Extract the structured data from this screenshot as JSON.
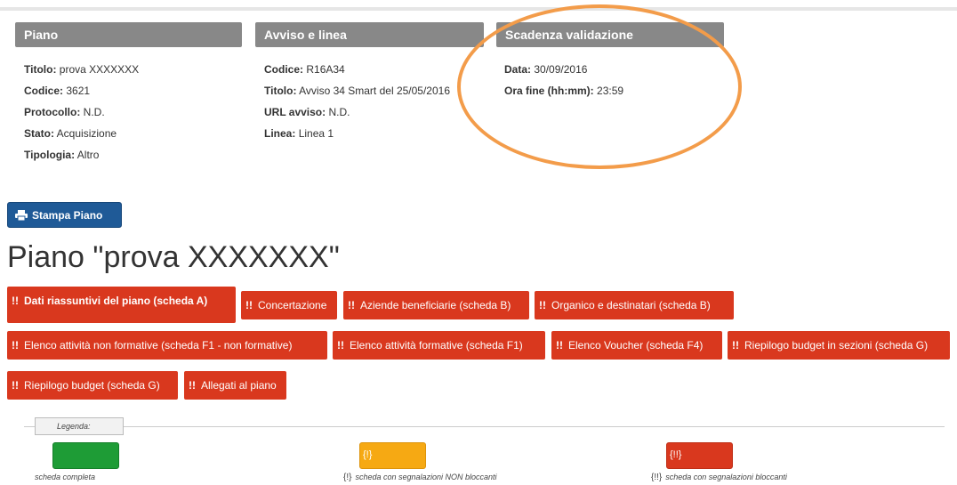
{
  "panels": {
    "piano": {
      "title": "Piano",
      "rows": [
        {
          "label": "Titolo:",
          "value": "prova XXXXXXX"
        },
        {
          "label": "Codice:",
          "value": "3621"
        },
        {
          "label": "Protocollo:",
          "value": "N.D."
        },
        {
          "label": "Stato:",
          "value": "Acquisizione"
        },
        {
          "label": "Tipologia:",
          "value": "Altro"
        }
      ]
    },
    "avviso": {
      "title": "Avviso e linea",
      "rows": [
        {
          "label": "Codice:",
          "value": "R16A34"
        },
        {
          "label": "Titolo:",
          "value": "Avviso 34 Smart del 25/05/2016"
        },
        {
          "label": "URL avviso:",
          "value": "N.D."
        },
        {
          "label": "Linea:",
          "value": "Linea 1"
        }
      ]
    },
    "scadenza": {
      "title": "Scadenza validazione",
      "rows": [
        {
          "label": "Data:",
          "value": "30/09/2016"
        },
        {
          "label": "Ora fine (hh:mm):",
          "value": "23:59"
        }
      ]
    }
  },
  "print_button": {
    "label": "Stampa Piano",
    "icon": "printer-icon"
  },
  "page_title": "Piano \"prova XXXXXXX\"",
  "tabs": [
    {
      "mark": "!!",
      "label": "Dati riassuntivi del piano (scheda A)"
    },
    {
      "mark": "!!",
      "label": "Concertazione"
    },
    {
      "mark": "!!",
      "label": "Aziende beneficiarie (scheda B)"
    },
    {
      "mark": "!!",
      "label": "Organico e destinatari (scheda B)"
    },
    {
      "mark": "!!",
      "label": "Elenco attività non formative (scheda F1 - non formative)"
    },
    {
      "mark": "!!",
      "label": "Elenco attività formative (scheda F1)"
    },
    {
      "mark": "!!",
      "label": "Elenco Voucher (scheda F4)"
    },
    {
      "mark": "!!",
      "label": "Riepilogo budget in sezioni (scheda G)"
    },
    {
      "mark": "!!",
      "label": "Riepilogo budget (scheda G)"
    },
    {
      "mark": "!!",
      "label": "Allegati al piano"
    }
  ],
  "legend": {
    "label": "Legenda:",
    "items": [
      {
        "swatch_text": "",
        "code": "",
        "desc": "scheda completa",
        "color": "#1e9c36"
      },
      {
        "swatch_text": "{!}",
        "code": "{!}",
        "desc": "scheda con segnalazioni NON bloccanti",
        "color": "#f6a913"
      },
      {
        "swatch_text": "{!!}",
        "code": "{!!}",
        "desc": "scheda con segnalazioni bloccanti",
        "color": "#d9381e"
      }
    ]
  },
  "colors": {
    "tab": "#d9381e",
    "panel_header": "#888888",
    "print_button": "#1f5a97",
    "highlight_oval": "#f39c4a"
  }
}
